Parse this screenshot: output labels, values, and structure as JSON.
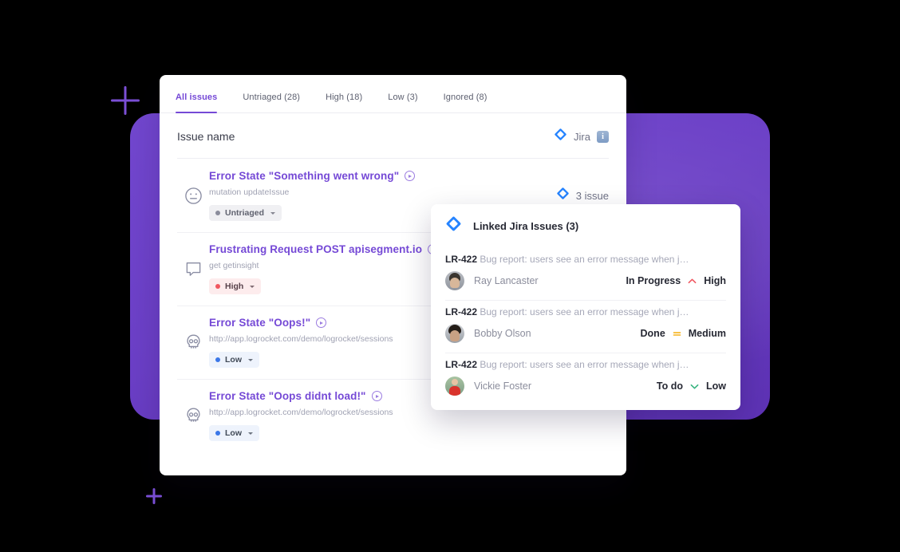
{
  "tabs": [
    {
      "label": "All issues",
      "active": true
    },
    {
      "label": "Untriaged (28)",
      "active": false
    },
    {
      "label": "High (18)",
      "active": false
    },
    {
      "label": "Low (3)",
      "active": false
    },
    {
      "label": "Ignored (8)",
      "active": false
    }
  ],
  "list_header": {
    "title": "Issue name",
    "jira_label": "Jira",
    "info_badge": "i"
  },
  "rows": [
    {
      "icon": "neutral-face-icon",
      "title": "Error State \"Something went wrong\"",
      "subtitle": "mutation updateIssue",
      "chip": {
        "label": "Untriaged",
        "style": "untriaged"
      },
      "right": "3 issue"
    },
    {
      "icon": "speech-bubble-icon",
      "title": "Frustrating Request POST apisegment.io",
      "subtitle": "get getinsight",
      "chip": {
        "label": "High",
        "style": "high"
      },
      "right": ""
    },
    {
      "icon": "skull-icon",
      "title": "Error State \"Oops!\"",
      "subtitle": "http://app.logrocket.com/demo/logrocket/sessions",
      "chip": {
        "label": "Low",
        "style": "low"
      },
      "right": ""
    },
    {
      "icon": "skull-icon",
      "title": "Error State \"Oops didnt load!\"",
      "subtitle": "http://app.logrocket.com/demo/logrocket/sessions",
      "chip": {
        "label": "Low",
        "style": "low"
      },
      "right": ""
    }
  ],
  "popup": {
    "title": "Linked Jira Issues (3)",
    "issues": [
      {
        "key": "LR-422",
        "summary": "Bug report: users see an error message when j…",
        "assignee": "Ray Lancaster",
        "status": "In Progress",
        "priority": "High",
        "priority_icon": "chevron-up-icon",
        "priority_color": "#f0565f"
      },
      {
        "key": "LR-422",
        "summary": "Bug report: users see an error message when j…",
        "assignee": "Bobby Olson",
        "status": "Done",
        "priority": "Medium",
        "priority_icon": "equals-icon",
        "priority_color": "#f5b31b"
      },
      {
        "key": "LR-422",
        "summary": "Bug report: users see an error message when j…",
        "assignee": "Vickie Foster",
        "status": "To do",
        "priority": "Low",
        "priority_icon": "chevron-down-icon",
        "priority_color": "#36b37e"
      }
    ]
  },
  "colors": {
    "brand_purple": "#7549d6",
    "panel_purple": "#6f42c9",
    "jira_blue": "#2684ff",
    "high_red": "#f0565f",
    "low_blue": "#3b77e8",
    "background": "#000000"
  },
  "decor": {
    "sparkle_top": "sparkle-icon",
    "sparkle_bottom": "sparkle-icon"
  }
}
